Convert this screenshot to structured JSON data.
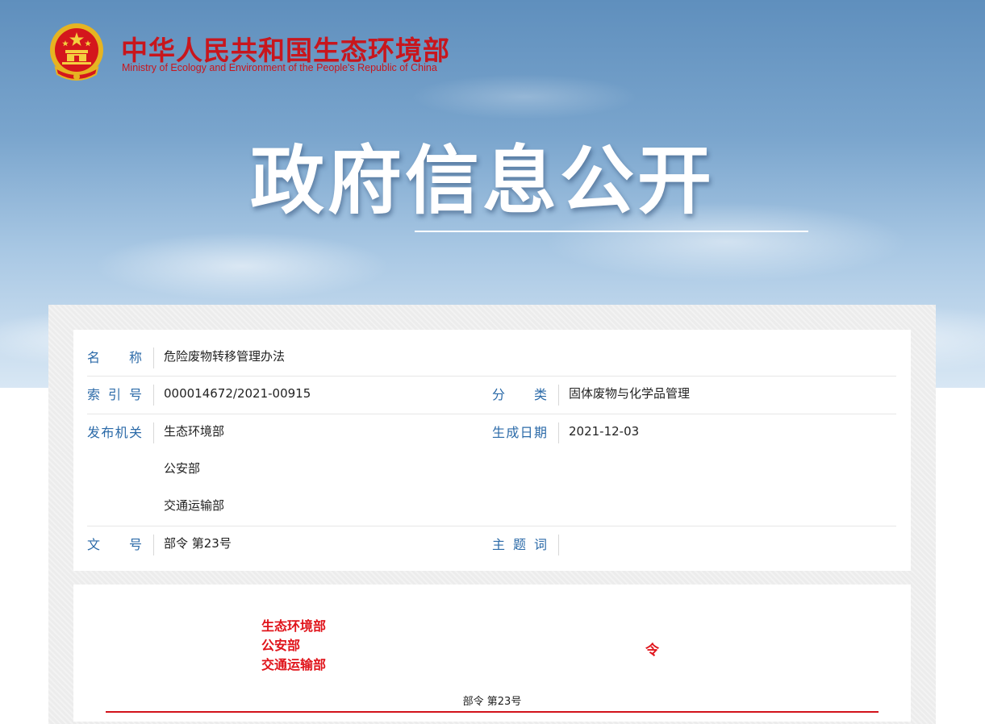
{
  "header": {
    "site_name_cn": "中华人民共和国生态环境部",
    "site_name_en": "Ministry of Ecology and Environment of the People's Republic of China",
    "emblem_icon": "national-emblem-icon",
    "banner_title": "政府信息公开",
    "colors": {
      "brand_red": "#c8161d",
      "label_blue": "#2b6aa8",
      "content_red": "#e0141b"
    }
  },
  "meta": {
    "name_label": "名　　称",
    "name_value": "危险废物转移管理办法",
    "index_label": "索引号",
    "index_value": "000014672/2021-00915",
    "category_label": "分　　类",
    "category_value": "固体废物与化学品管理",
    "issuer_label": "发布机关",
    "issuers": [
      "生态环境部",
      "公安部",
      "交通运输部"
    ],
    "date_label": "生成日期",
    "date_value": "2021-12-03",
    "docno_label": "文　　号",
    "docno_value": "部令 第23号",
    "subject_label": "主题词",
    "subject_value": ""
  },
  "content": {
    "issuers": [
      "生态环境部",
      "公安部",
      "交通运输部"
    ],
    "order_char": "令",
    "order_no": "部令 第23号"
  }
}
